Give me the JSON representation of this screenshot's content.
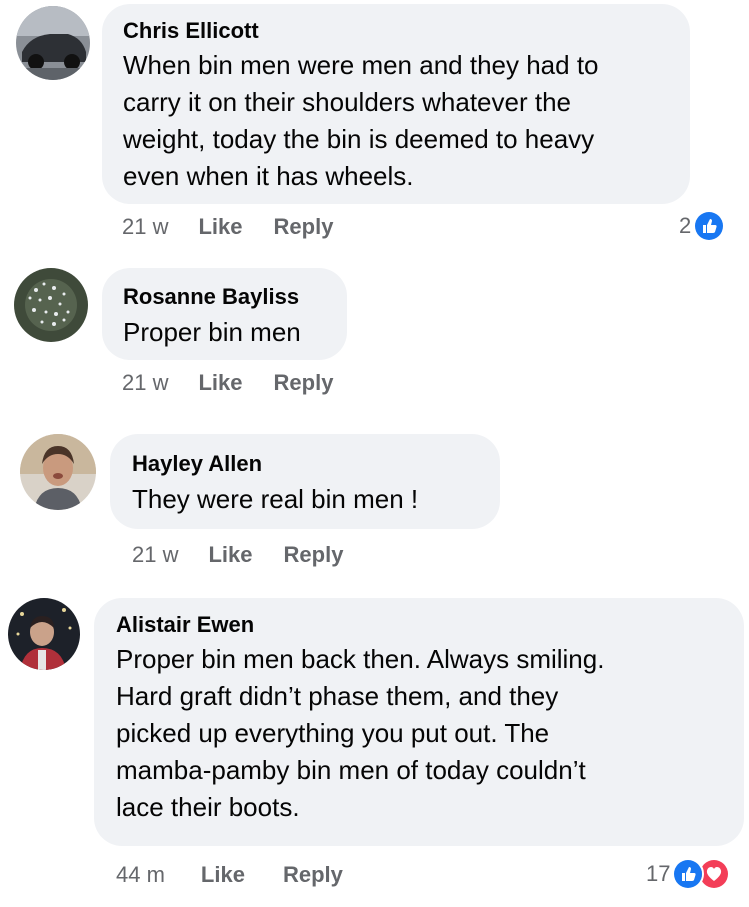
{
  "comments": [
    {
      "author": "Chris Ellicott",
      "lines": [
        "When bin men were men and they had to",
        "carry it on their shoulders whatever the",
        "weight, today the bin is deemed to heavy",
        "even when it has wheels."
      ],
      "time": "21 w",
      "like": "Like",
      "reply": "Reply",
      "reaction_count": "2",
      "reactions": [
        "like-icon"
      ]
    },
    {
      "author": "Rosanne Bayliss",
      "lines": [
        "Proper bin men"
      ],
      "time": "21 w",
      "like": "Like",
      "reply": "Reply"
    },
    {
      "author": "Hayley Allen",
      "lines": [
        "They were real bin men !"
      ],
      "time": "21 w",
      "like": "Like",
      "reply": "Reply"
    },
    {
      "author": "Alistair Ewen",
      "lines": [
        "Proper bin men back then. Always smiling.",
        "Hard graft didn’t phase them, and they",
        "picked up everything you put out. The",
        "mamba-pamby bin men of today couldn’t",
        "lace their boots."
      ],
      "time": "44 m",
      "like": "Like",
      "reply": "Reply",
      "reaction_count": "17",
      "reactions": [
        "like-icon",
        "love-icon"
      ]
    }
  ],
  "colors": {
    "bubble": "#f0f2f5",
    "meta_text": "#65676b",
    "like_blue": "#1877f2",
    "love_red": "#f33e58"
  }
}
